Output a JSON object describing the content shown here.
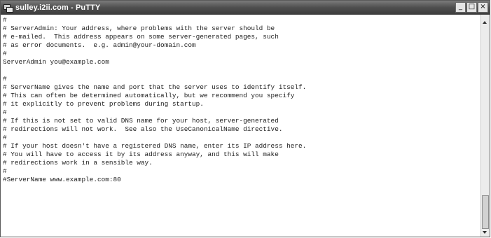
{
  "window": {
    "title": "sulley.i2ii.com - PuTTY",
    "controls": {
      "minimize": "_",
      "maximize": "□",
      "close": "×"
    }
  },
  "terminal": {
    "lines": [
      "#",
      "# ServerAdmin: Your address, where problems with the server should be",
      "# e-mailed.  This address appears on some server-generated pages, such",
      "# as error documents.  e.g. admin@your-domain.com",
      "#",
      "ServerAdmin you@example.com",
      "",
      "#",
      "# ServerName gives the name and port that the server uses to identify itself.",
      "# This can often be determined automatically, but we recommend you specify",
      "# it explicitly to prevent problems during startup.",
      "#",
      "# If this is not set to valid DNS name for your host, server-generated",
      "# redirections will not work.  See also the UseCanonicalName directive.",
      "#",
      "# If your host doesn't have a registered DNS name, enter its IP address here.",
      "# You will have to access it by its address anyway, and this will make",
      "# redirections work in a sensible way.",
      "#",
      "#ServerName www.example.com:80",
      ""
    ]
  },
  "scrollbar": {
    "position_fraction": 0.85
  }
}
